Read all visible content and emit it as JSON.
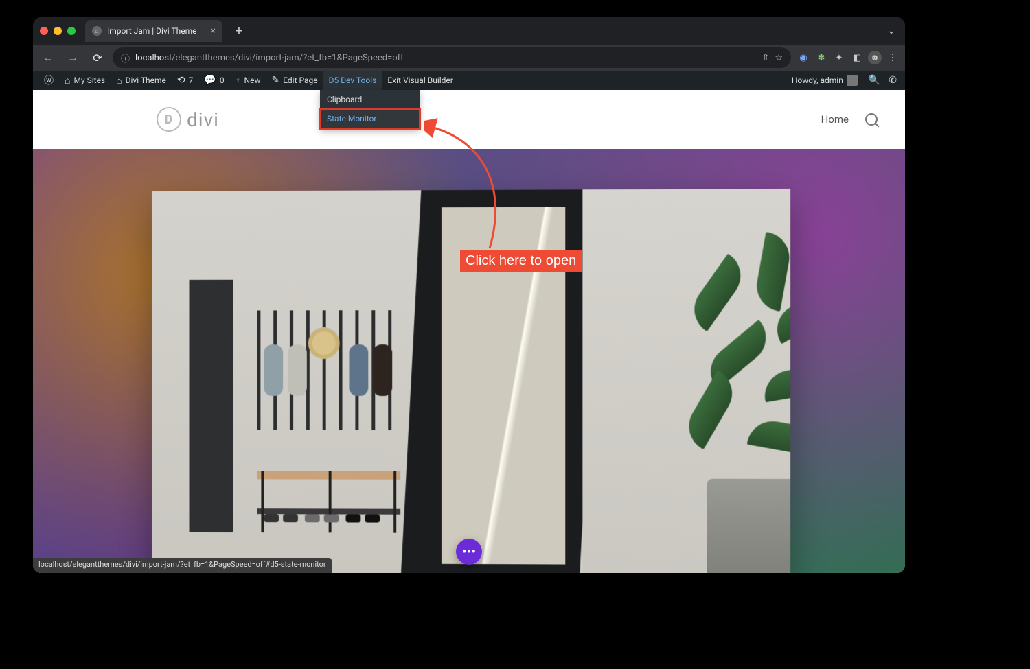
{
  "browser": {
    "tab_title": "Import Jam | Divi Theme",
    "url_host": "localhost",
    "url_path": "/elegantthemes/divi/import-jam/?et_fb=1&PageSpeed=off",
    "status_url": "localhost/elegantthemes/divi/import-jam/?et_fb=1&PageSpeed=off#d5-state-monitor"
  },
  "wp_admin": {
    "my_sites": "My Sites",
    "site_name": "Divi Theme",
    "updates_count": "7",
    "comments_count": "0",
    "new_label": "New",
    "edit_page": "Edit Page",
    "dev_tools": "D5 Dev Tools",
    "exit_builder": "Exit Visual Builder",
    "howdy": "Howdy, admin"
  },
  "dropdown": {
    "item1": "Clipboard",
    "item2": "State Monitor"
  },
  "annotation": {
    "label": "Click here to open"
  },
  "site": {
    "logo_text": "divi",
    "nav_home": "Home"
  },
  "fab": {
    "dots": "•••"
  }
}
